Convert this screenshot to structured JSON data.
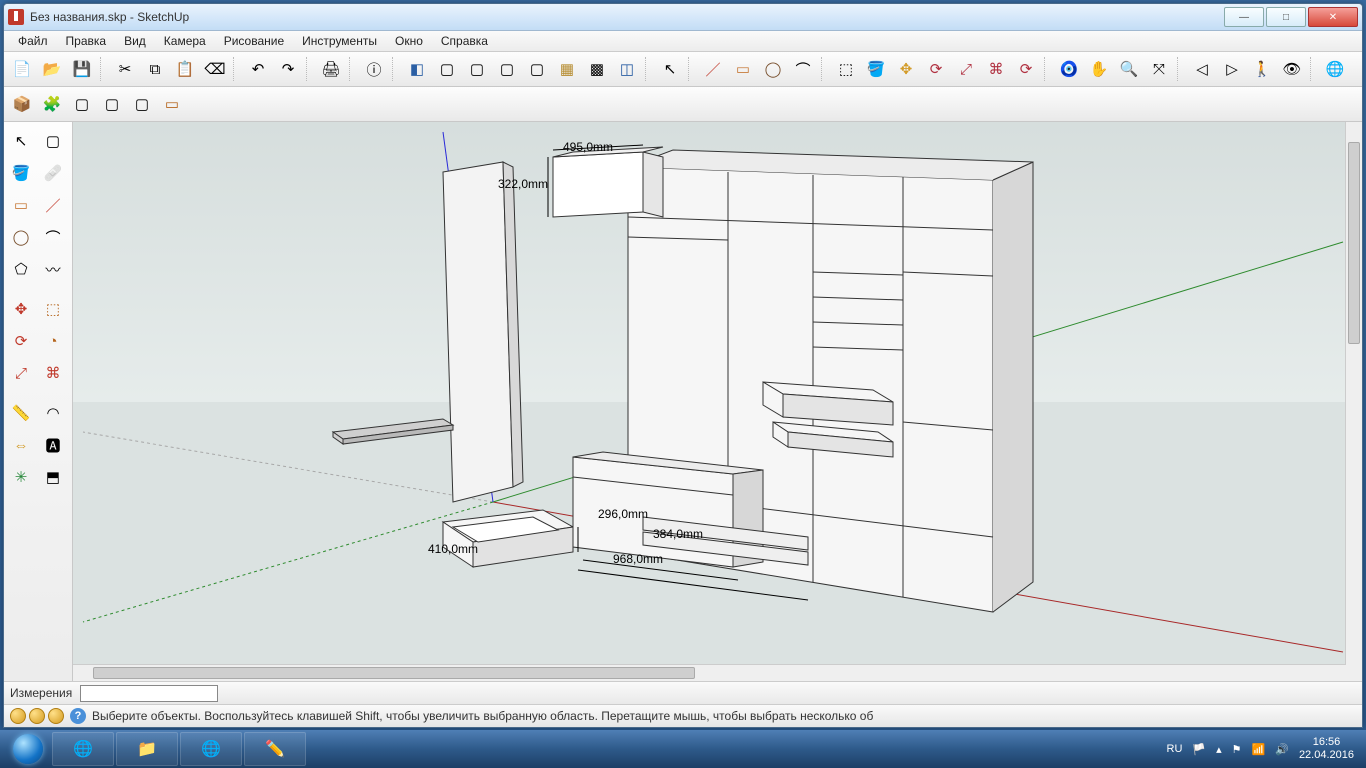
{
  "window": {
    "title": "Без названия.skp - SketchUp",
    "minimize": "—",
    "maximize": "□",
    "close": "✕"
  },
  "menu": {
    "file": "Файл",
    "edit": "Правка",
    "view": "Вид",
    "camera": "Камера",
    "draw": "Рисование",
    "tools": "Инструменты",
    "window": "Окно",
    "help": "Справка"
  },
  "vcb": {
    "label": "Измерения",
    "value": ""
  },
  "status": {
    "hint": "Выберите объекты. Воспользуйтесь клавишей Shift, чтобы увеличить выбранную область. Перетащите мышь, чтобы выбрать несколько об"
  },
  "dimensions": {
    "d1": "495,0mm",
    "d2": "322,0mm",
    "d3": "296,0mm",
    "d4": "384,0mm",
    "d5": "968,0mm",
    "d6": "410,0mm"
  },
  "taskbar": {
    "lang": "RU",
    "time": "16:56",
    "date": "22.04.2016"
  },
  "icons": {
    "new": "📄",
    "open": "📂",
    "save": "💾",
    "cut": "✂",
    "copy": "⧉",
    "paste": "📋",
    "erase": "⌫",
    "undo": "↶",
    "redo": "↷",
    "print": "🖨",
    "model_info": "ⓘ",
    "iso": "◧",
    "front": "▢",
    "back": "▢",
    "top": "▢",
    "right": "▢",
    "textured": "▦",
    "mono": "▩",
    "xray": "◫",
    "select": "↖",
    "line": "／",
    "rect": "▭",
    "circle": "◯",
    "arc": "⌒",
    "push": "⬚",
    "paint": "🪣",
    "move": "✥",
    "rotate": "⟳",
    "scale": "⤢",
    "offset": "⌘",
    "tape": "📏",
    "protractor": "◠",
    "dim": "⇔",
    "text": "🅰",
    "axes": "✳",
    "section": "⬒",
    "orbit": "🧿",
    "pan": "✋",
    "zoom": "🔍",
    "zoom_ext": "⤧",
    "prev": "◁",
    "next": "▷",
    "walk": "🚶",
    "look": "👁",
    "google": "🌐",
    "eraser": "🩹",
    "poly": "⬠",
    "freehand": "〰",
    "pie": "◔",
    "comp": "📦",
    "group": "🧩"
  }
}
